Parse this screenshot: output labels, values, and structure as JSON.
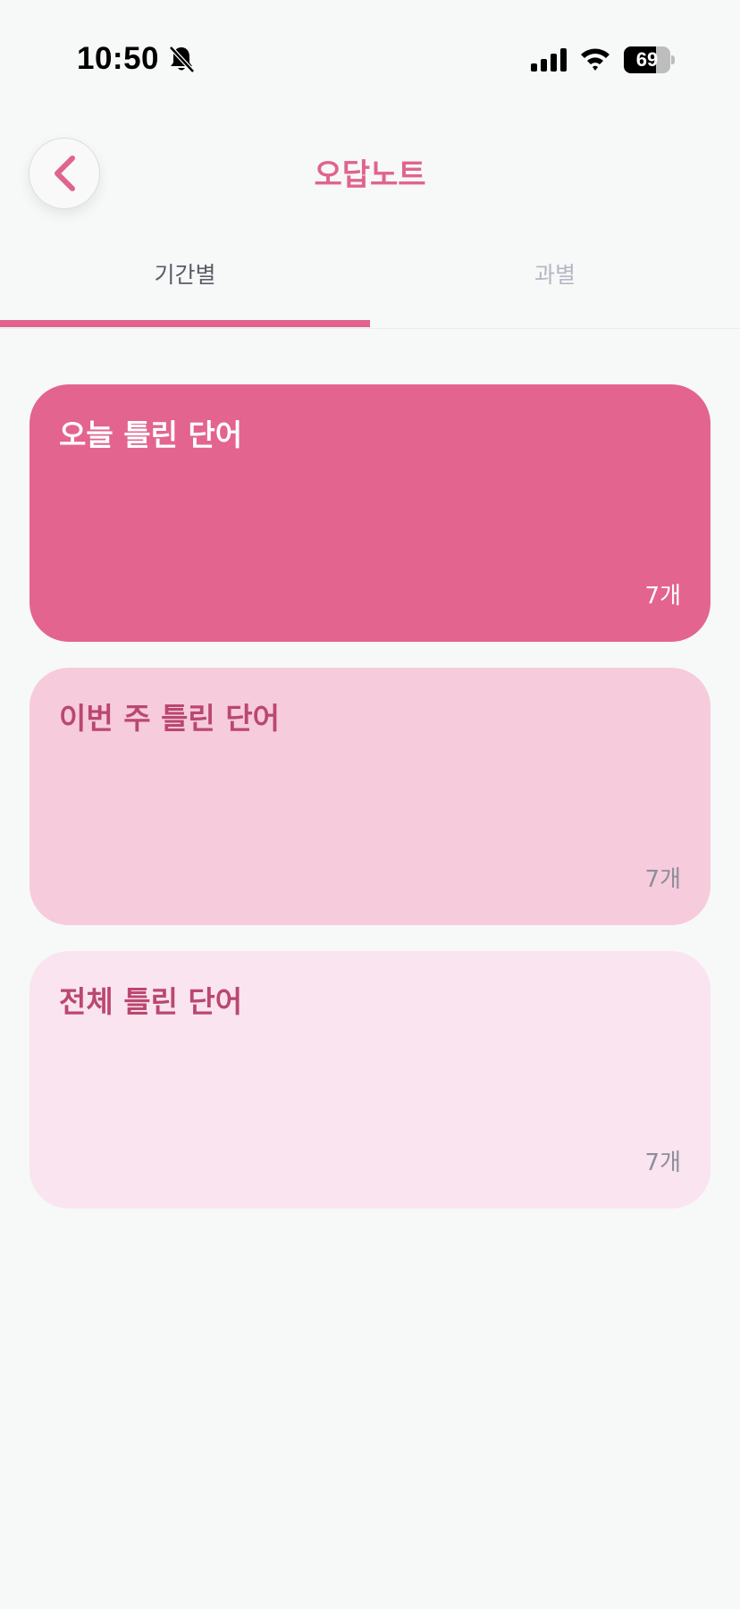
{
  "status_bar": {
    "time": "10:50",
    "battery_level": "69",
    "battery_fraction": 0.69,
    "icons": [
      "bell-slash-icon",
      "signal-icon",
      "wifi-icon",
      "battery-icon"
    ]
  },
  "header": {
    "title": "오답노트",
    "back_icon": "chevron-left-icon"
  },
  "tabs": [
    {
      "label": "기간별",
      "selected": true
    },
    {
      "label": "과별",
      "selected": false
    }
  ],
  "cards": [
    {
      "title": "오늘 틀린 단어",
      "count": "7개"
    },
    {
      "title": "이번 주 틀린 단어",
      "count": "7개"
    },
    {
      "title": "전체 틀린 단어",
      "count": "7개"
    }
  ],
  "colors": {
    "accent": "#e0648c",
    "card_today": "#e3648f",
    "card_week": "#f6cbdc",
    "card_all": "#f9e4ef",
    "background": "#f7f8f8"
  }
}
